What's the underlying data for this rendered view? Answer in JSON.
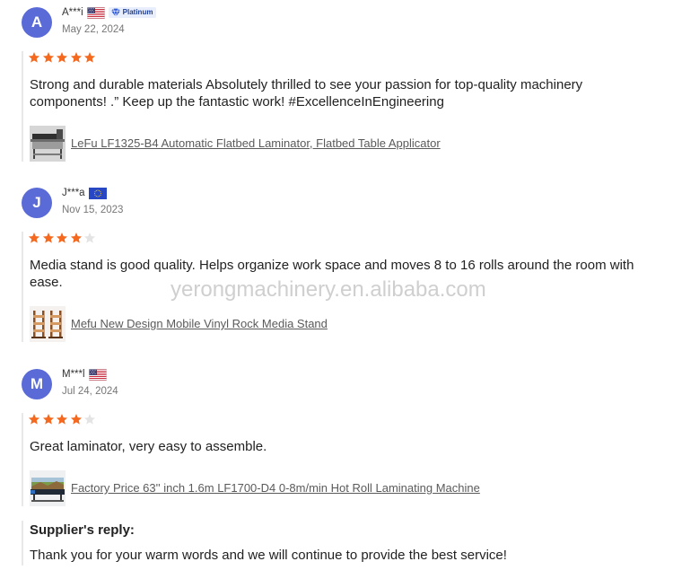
{
  "reviews": [
    {
      "avatar_letter": "A",
      "name": "A***i",
      "flag_icon": "us-flag-icon",
      "badge": {
        "label": "Platinum",
        "icon": "diamond-icon"
      },
      "date": "May 22, 2024",
      "rating": 5,
      "max_rating": 5,
      "text": "Strong and durable materials Absolutely thrilled to see your passion for top-quality machinery components! .” Keep up the fantastic work! #ExcellenceInEngineering",
      "product": {
        "thumbnail_icon": "flatbed-laminator-thumbnail",
        "title": "LeFu LF1325-B4 Automatic Flatbed Laminator, Flatbed Table Applicator"
      }
    },
    {
      "avatar_letter": "J",
      "name": "J***a",
      "flag_icon": "eu-flag-icon",
      "date": "Nov 15, 2023",
      "rating": 4,
      "max_rating": 5,
      "text": "Media stand is good quality. Helps organize work space and moves 8 to 16 rolls around the room with ease.",
      "product": {
        "thumbnail_icon": "media-stand-thumbnail",
        "title": "Mefu New Design Mobile Vinyl Rock Media Stand"
      }
    },
    {
      "avatar_letter": "M",
      "name": "M***l",
      "flag_icon": "us-flag-icon",
      "date": "Jul 24, 2024",
      "rating": 4,
      "max_rating": 5,
      "text": "Great laminator, very easy to assemble.",
      "product": {
        "thumbnail_icon": "hot-roll-laminator-thumbnail",
        "title": "Factory Price 63'' inch 1.6m LF1700-D4 0-8m/min Hot Roll Laminating Machine"
      }
    }
  ],
  "supplier_reply": {
    "label": "Supplier's reply:",
    "text": "Thank you for your warm words and we will continue to provide the best service!"
  },
  "watermark": "yerongmachinery.en.alibaba.com",
  "colors": {
    "avatar_bg": "#5a6ad6",
    "star_filled": "#f4691e",
    "star_empty": "#e4e4e4",
    "badge_bg": "#e8eefc",
    "badge_text": "#1e3e98"
  }
}
